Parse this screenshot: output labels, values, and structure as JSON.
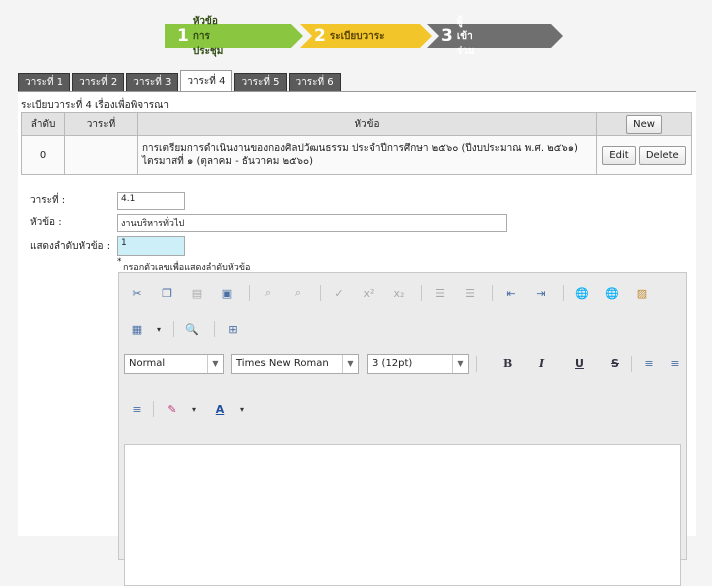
{
  "wizard": {
    "steps": [
      {
        "num": "1",
        "label": "หัวข้อการประชุม",
        "color": "#8ac640"
      },
      {
        "num": "2",
        "label": "ระเบียบวาระ",
        "color": "#f2c62b"
      },
      {
        "num": "3",
        "label": "ผู้เข้าร่วม",
        "color": "#6f6f6f"
      }
    ]
  },
  "tabs": [
    "วาระที่ 1",
    "วาระที่ 2",
    "วาระที่ 3",
    "วาระที่ 4",
    "วาระที่ 5",
    "วาระที่ 6"
  ],
  "active_tab": 3,
  "section_caption": "ระเบียบวาระที่ 4 เรื่องเพื่อพิจารณา",
  "table": {
    "headers": {
      "order": "ลำดับ",
      "agenda": "วาระที่",
      "topic": "หัวข้อ"
    },
    "new_button": "New",
    "rows": [
      {
        "order": "0",
        "agenda": "",
        "topic": "การเตรียมการดำเนินงานของกองศิลปวัฒนธรรม ประจำปีการศึกษา ๒๕๖๐ (ปีงบประมาณ พ.ศ. ๒๕๖๑) ไตรมาสที่ ๑ (ตุลาคม - ธันวาคม ๒๕๖๐)",
        "edit": "Edit",
        "delete": "Delete"
      }
    ]
  },
  "form": {
    "agenda_label": "วาระที่ :",
    "agenda_value": "4.1",
    "topic_label": "หัวข้อ :",
    "topic_value": "งานบริหารทั่วไป",
    "order_label": "แสดงลำดับหัวข้อ :",
    "order_value": "1",
    "order_hint": "กรอกตัวเลขเพื่อแสดงลำดับหัวข้อ",
    "required_mark": "*"
  },
  "editor": {
    "format_value": "Normal",
    "font_value": "Times New Roman",
    "size_value": "3 (12pt)",
    "bold": "B",
    "italic": "I",
    "underline": "U",
    "strike": "S",
    "font_color": "A"
  }
}
